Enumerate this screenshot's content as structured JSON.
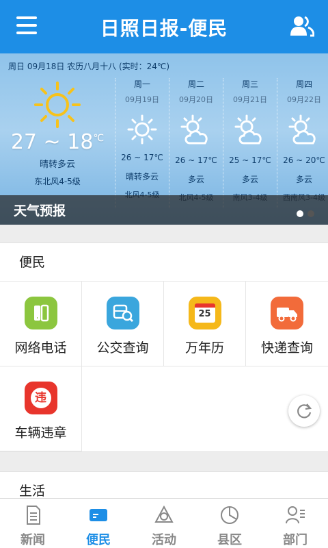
{
  "app": {
    "title": "日照日报-便民"
  },
  "weather": {
    "date_line": "周日 09月18日 农历八月十八 (实时：24℃)",
    "today": {
      "temp": "27 ~ 18",
      "unit": "℃",
      "condition": "晴转多云",
      "wind": "东北风4-5级"
    },
    "forecast": [
      {
        "day": "周一",
        "date": "09月19日",
        "range": "26 ~ 17℃",
        "condition": "晴转多云",
        "wind": "北风4-5级",
        "icon": "sun-icon"
      },
      {
        "day": "周二",
        "date": "09月20日",
        "range": "26 ~ 17℃",
        "condition": "多云",
        "wind": "北风4-5级",
        "icon": "partly-cloudy-icon"
      },
      {
        "day": "周三",
        "date": "09月21日",
        "range": "25 ~ 17℃",
        "condition": "多云",
        "wind": "南风3-4级",
        "icon": "partly-cloudy-icon"
      },
      {
        "day": "周四",
        "date": "09月22日",
        "range": "26 ~ 20℃",
        "condition": "多云",
        "wind": "西南风3-4级",
        "icon": "partly-cloudy-icon"
      }
    ],
    "caption": "天气预报",
    "page_dots": 2,
    "active_dot": 0
  },
  "bianmin": {
    "heading": "便民",
    "items": [
      {
        "label": "网络电话",
        "icon": "phone-icon",
        "color": "#8cc63f"
      },
      {
        "label": "公交查询",
        "icon": "bus-search-icon",
        "color": "#3aa6dd"
      },
      {
        "label": "万年历",
        "icon": "calendar-icon",
        "color": "#f5b81a",
        "icon_text": "25"
      },
      {
        "label": "快递查询",
        "icon": "delivery-truck-icon",
        "color": "#f26b3a"
      },
      {
        "label": "车辆违章",
        "icon": "violation-icon",
        "color": "#e8352c",
        "icon_text": "违"
      }
    ]
  },
  "life": {
    "heading": "生活"
  },
  "tabbar": {
    "active": 1,
    "tabs": [
      {
        "label": "新闻",
        "icon": "news-icon"
      },
      {
        "label": "便民",
        "icon": "card-icon"
      },
      {
        "label": "活动",
        "icon": "activity-icon"
      },
      {
        "label": "县区",
        "icon": "pie-icon"
      },
      {
        "label": "部门",
        "icon": "department-icon"
      }
    ]
  },
  "colors": {
    "primary": "#1d8ee6",
    "inactive": "#888888"
  }
}
